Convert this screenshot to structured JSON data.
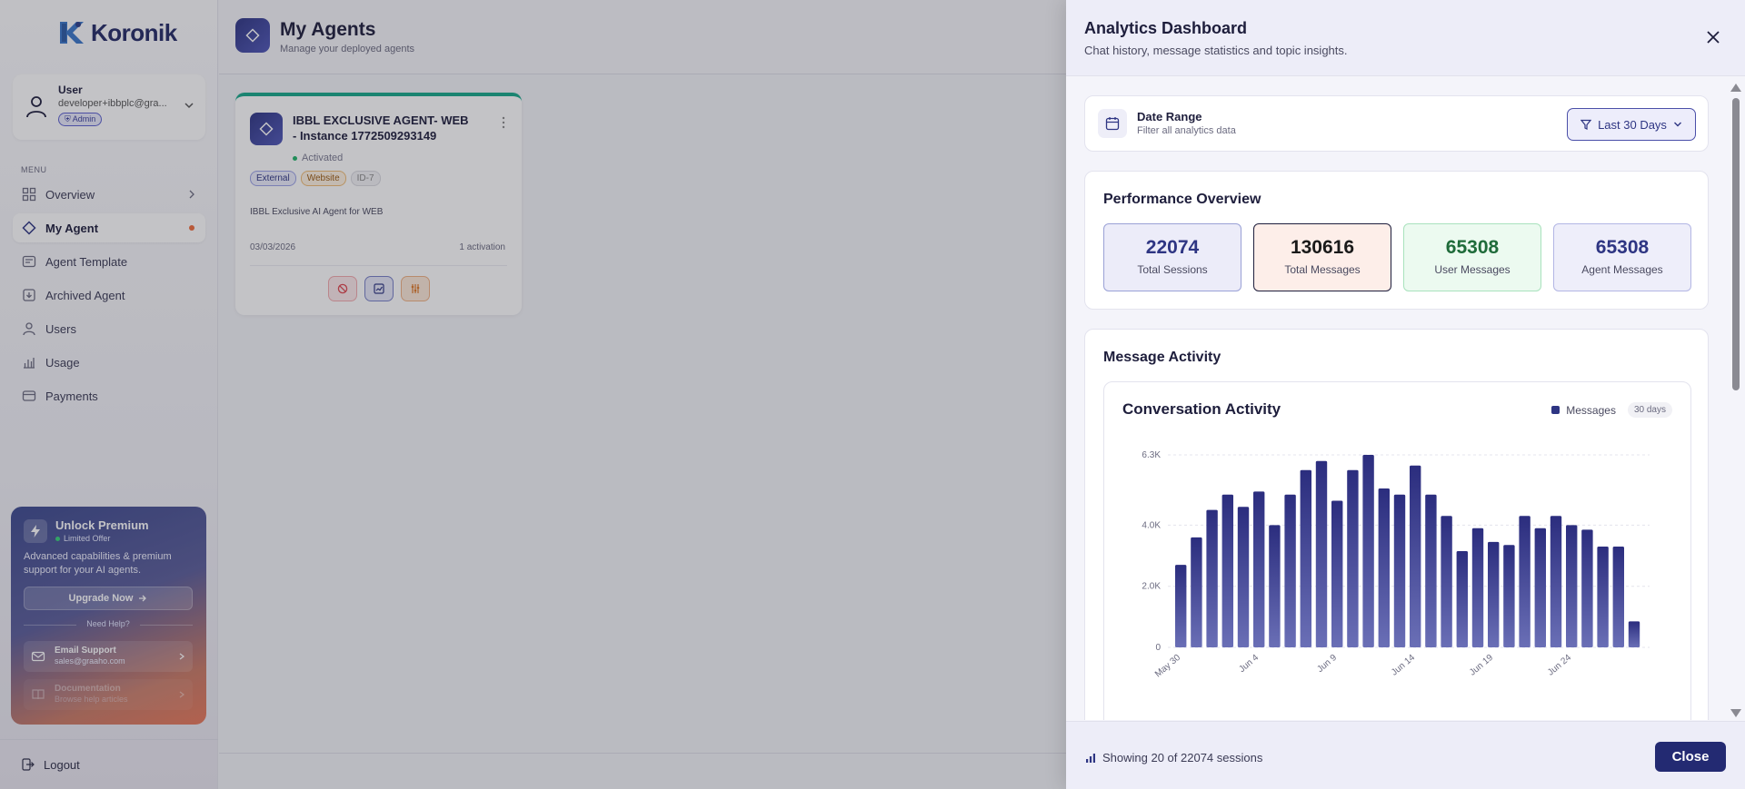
{
  "brand": {
    "name": "Koronik"
  },
  "user": {
    "name": "User",
    "email": "developer+ibbplc@gra...",
    "role": "Admin"
  },
  "menu": {
    "label": "MENU",
    "items": [
      {
        "label": "Overview"
      },
      {
        "label": "My Agent"
      },
      {
        "label": "Agent Template"
      },
      {
        "label": "Archived Agent"
      },
      {
        "label": "Users"
      },
      {
        "label": "Usage"
      },
      {
        "label": "Payments"
      }
    ]
  },
  "premium": {
    "title": "Unlock Premium",
    "offer": "Limited Offer",
    "description": "Advanced capabilities & premium support for your AI agents.",
    "button": "Upgrade Now",
    "help": "Need Help?",
    "email_title": "Email Support",
    "email": "sales@graaho.com",
    "docs_title": "Documentation",
    "docs_sub": "Browse help articles"
  },
  "logout": "Logout",
  "page": {
    "title": "My Agents",
    "subtitle": "Manage your deployed agents"
  },
  "agent": {
    "title": "IBBL EXCLUSIVE AGENT- WEB - Instance 1772509293149",
    "status": "Activated",
    "tags": [
      "External",
      "Website",
      "ID-7"
    ],
    "description": "IBBL Exclusive AI Agent for WEB",
    "date": "03/03/2026",
    "activations": "1 activation"
  },
  "drawer": {
    "title": "Analytics Dashboard",
    "subtitle": "Chat history, message statistics and topic insights.",
    "date_range": {
      "label": "Date Range",
      "sub": "Filter all analytics data",
      "selected": "Last 30 Days"
    },
    "performance": {
      "title": "Performance Overview",
      "stats": [
        {
          "value": "22074",
          "label": "Total Sessions"
        },
        {
          "value": "130616",
          "label": "Total Messages"
        },
        {
          "value": "65308",
          "label": "User Messages"
        },
        {
          "value": "65308",
          "label": "Agent Messages"
        }
      ]
    },
    "activity": {
      "title": "Message Activity"
    },
    "footer": {
      "text": "Showing 20 of 22074 sessions",
      "close": "Close"
    },
    "colors": {
      "accent": "#2e3583",
      "bar_top": "#2b2d7e",
      "bar_bottom": "#6a6fb6"
    }
  },
  "chart_data": {
    "type": "bar",
    "title": "Conversation Activity",
    "legend": "Messages",
    "range_pill": "30 days",
    "xlabel": "",
    "ylabel": "",
    "yticks": [
      "0",
      "2.0K",
      "4.0K",
      "6.3K"
    ],
    "ytick_values": [
      0,
      2000,
      4000,
      6300
    ],
    "ylim": [
      0,
      6300
    ],
    "xtick_labels": [
      {
        "index": 0,
        "label": "May 30"
      },
      {
        "index": 5,
        "label": "Jun 4"
      },
      {
        "index": 10,
        "label": "Jun 9"
      },
      {
        "index": 15,
        "label": "Jun 14"
      },
      {
        "index": 20,
        "label": "Jun 19"
      },
      {
        "index": 25,
        "label": "Jun 24"
      }
    ],
    "grid": true,
    "values": [
      2700,
      3600,
      4500,
      5000,
      4600,
      5100,
      4000,
      5000,
      5800,
      6100,
      4800,
      5800,
      6300,
      5200,
      5000,
      5950,
      5000,
      4300,
      3150,
      3900,
      3450,
      3350,
      4300,
      3900,
      4300,
      4000,
      3850,
      3300,
      3300,
      850
    ]
  }
}
